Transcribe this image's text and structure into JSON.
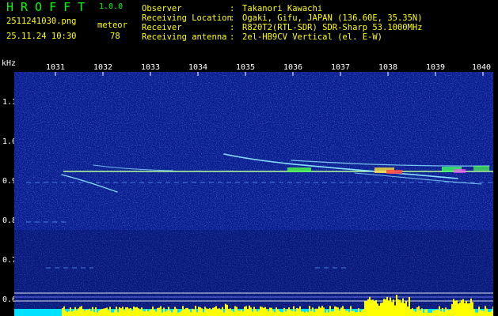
{
  "app": {
    "title": "HROFFT",
    "version": "1.0.0"
  },
  "file": {
    "name": "2511241030.png",
    "datetime": "25.11.24 10:30"
  },
  "meteor": {
    "label": "meteor",
    "count": "78"
  },
  "info": [
    {
      "label": "Observer",
      "value": "Takanori Kawachi"
    },
    {
      "label": "Receiving Location",
      "value": "Ogaki, Gifu, JAPAN (136.60E, 35.35N)"
    },
    {
      "label": "Receiver",
      "value": "R820T2(RTL-SDR) SDR-Sharp 53.1000MHz"
    },
    {
      "label": "Receiving antenna",
      "value": "2el-HB9CV Vertical (el. E-W)"
    }
  ],
  "axis": {
    "unit": "kHz",
    "x_ticks": [
      "1031",
      "1032",
      "1033",
      "1034",
      "1035",
      "1036",
      "1037",
      "1038",
      "1039",
      "1040"
    ],
    "y_ticks": [
      "1.1",
      "1.0",
      "0.9",
      "0.8",
      "0.7",
      "0.6"
    ]
  },
  "colors": {
    "background": "#000000",
    "header_text": "#ffff00",
    "title_text": "#00ff00",
    "waterfall_base": "#061a8c",
    "signal_line": "#b8ff9a",
    "meteor_trace": "#88e0ff",
    "activity_bar": "#ffff00",
    "baseline_bar": "#00e0ff"
  }
}
